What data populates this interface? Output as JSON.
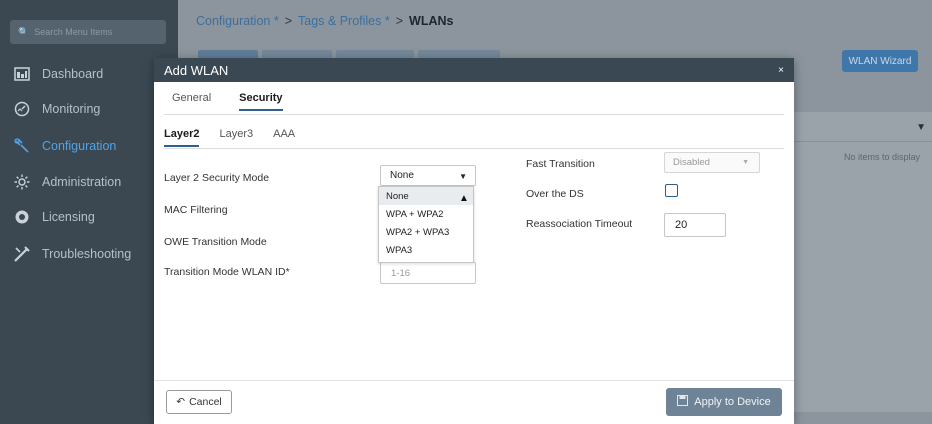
{
  "sidebar": {
    "search_placeholder": "Search Menu Items",
    "items": [
      {
        "label": "Dashboard",
        "icon": "dashboard-icon"
      },
      {
        "label": "Monitoring",
        "icon": "monitoring-icon"
      },
      {
        "label": "Configuration",
        "icon": "configuration-icon"
      },
      {
        "label": "Administration",
        "icon": "administration-icon"
      },
      {
        "label": "Licensing",
        "icon": "licensing-icon"
      },
      {
        "label": "Troubleshooting",
        "icon": "troubleshooting-icon"
      }
    ],
    "active_item": "Configuration"
  },
  "breadcrumb": {
    "items": [
      "Configuration *",
      "Tags & Profiles *",
      "WLANs"
    ],
    "separator": ">"
  },
  "background": {
    "wizard_label": "WLAN Wizard",
    "empty_table_text": "No items to display"
  },
  "modal": {
    "title": "Add WLAN",
    "close_glyph": "×",
    "tabs": [
      "General",
      "Security"
    ],
    "active_tab": "Security",
    "subtabs": [
      "Layer2",
      "Layer3",
      "AAA"
    ],
    "active_subtab": "Layer2",
    "left": {
      "security_mode_label": "Layer 2 Security Mode",
      "security_mode_value": "None",
      "security_mode_options": [
        "None",
        "WPA + WPA2",
        "WPA2 + WPA3",
        "WPA3"
      ],
      "mac_filtering_label": "MAC Filtering",
      "owe_label": "OWE Transition Mode",
      "transition_id_label": "Transition Mode WLAN ID*",
      "transition_id_placeholder": "1-16"
    },
    "right": {
      "fast_transition_label": "Fast Transition",
      "fast_transition_value": "Disabled",
      "over_ds_label": "Over the DS",
      "reassoc_label": "Reassociation Timeout",
      "reassoc_value": "20"
    },
    "footer": {
      "cancel_label": "Cancel",
      "apply_label": "Apply to Device"
    }
  },
  "colors": {
    "sidebar_bg": "#3b4852",
    "accent": "#2e5f8e",
    "active_nav": "#4fa3e6",
    "apply_button": "#6e8396"
  }
}
